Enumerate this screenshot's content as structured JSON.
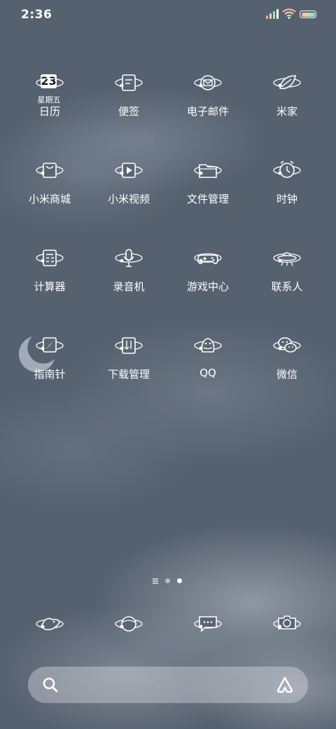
{
  "status_bar": {
    "time": "2:36",
    "icons": [
      "signal-icon",
      "wifi-icon",
      "battery-icon"
    ]
  },
  "calendar": {
    "day": "23",
    "weekday": "星期五"
  },
  "apps": [
    {
      "label": "日历",
      "icon": "calendar-icon"
    },
    {
      "label": "便签",
      "icon": "notes-icon"
    },
    {
      "label": "电子邮件",
      "icon": "email-icon"
    },
    {
      "label": "米家",
      "icon": "leaf-icon"
    },
    {
      "label": "小米商城",
      "icon": "shopping-bag-icon"
    },
    {
      "label": "小米视频",
      "icon": "video-icon"
    },
    {
      "label": "文件管理",
      "icon": "folder-icon"
    },
    {
      "label": "时钟",
      "icon": "alarm-clock-icon"
    },
    {
      "label": "计算器",
      "icon": "calculator-icon"
    },
    {
      "label": "录音机",
      "icon": "microphone-icon"
    },
    {
      "label": "游戏中心",
      "icon": "gamepad-icon"
    },
    {
      "label": "联系人",
      "icon": "ufo-icon"
    },
    {
      "label": "指南针",
      "icon": "compass-icon"
    },
    {
      "label": "下载管理",
      "icon": "download-icon"
    },
    {
      "label": "QQ",
      "icon": "penguin-icon"
    },
    {
      "label": "微信",
      "icon": "chat-bubbles-icon"
    }
  ],
  "page_indicator": {
    "pages": 2,
    "active_page": 2
  },
  "dock": [
    "bird-icon",
    "planet-icon",
    "message-icon",
    "camera-icon"
  ],
  "search_bar": {
    "icons": [
      "search-icon",
      "ai-assistant-icon"
    ]
  },
  "colors": {
    "wallpaper": "#56616f",
    "battery_gradient": [
      "#f4a8c0",
      "#f5d58a",
      "#9fe6b0",
      "#9cc6f5"
    ]
  }
}
